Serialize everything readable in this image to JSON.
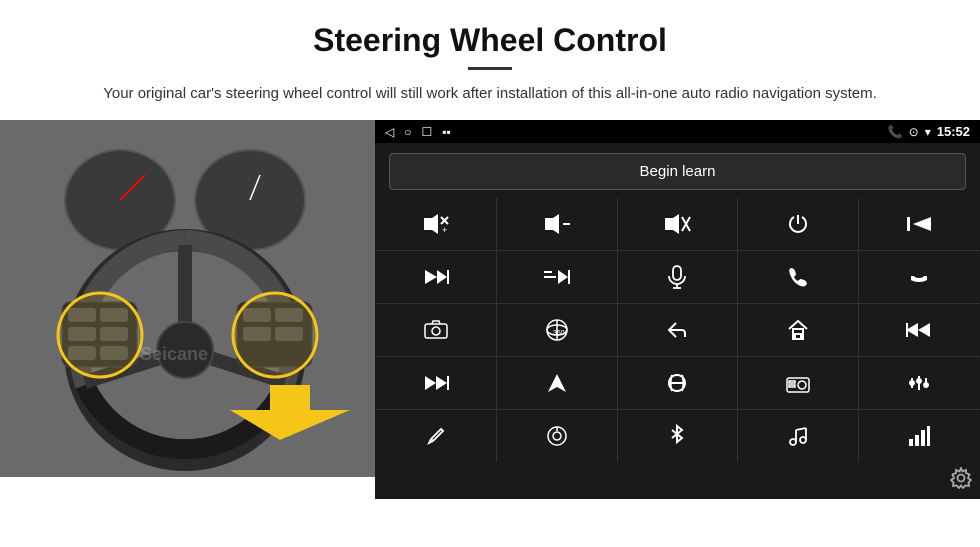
{
  "header": {
    "title": "Steering Wheel Control",
    "subtitle": "Your original car's steering wheel control will still work after installation of this all-in-one auto radio navigation system."
  },
  "status_bar": {
    "back_icon": "◁",
    "circle_icon": "○",
    "square_icon": "☐",
    "battery_icon": "▪▪",
    "phone_icon": "📞",
    "location_icon": "⊙",
    "wifi_icon": "▾",
    "time": "15:52"
  },
  "begin_learn": {
    "label": "Begin learn"
  },
  "watermark": "Seicane",
  "controls": [
    {
      "icon": "🔊+",
      "label": "vol-up"
    },
    {
      "icon": "🔊−",
      "label": "vol-down"
    },
    {
      "icon": "🔇",
      "label": "mute"
    },
    {
      "icon": "⏻",
      "label": "power"
    },
    {
      "icon": "⏮",
      "label": "prev-phone"
    },
    {
      "icon": "⏭",
      "label": "next"
    },
    {
      "icon": "✂⏭",
      "label": "skip"
    },
    {
      "icon": "🎤",
      "label": "mic"
    },
    {
      "icon": "📞",
      "label": "call"
    },
    {
      "icon": "📞↩",
      "label": "hang-up"
    },
    {
      "icon": "📷",
      "label": "camera"
    },
    {
      "icon": "360°",
      "label": "360-view"
    },
    {
      "icon": "↩",
      "label": "back"
    },
    {
      "icon": "⌂",
      "label": "home"
    },
    {
      "icon": "⏮⏮",
      "label": "prev"
    },
    {
      "icon": "⏭⏭",
      "label": "fast-fwd"
    },
    {
      "icon": "➤",
      "label": "nav"
    },
    {
      "icon": "⇄",
      "label": "source"
    },
    {
      "icon": "📻",
      "label": "radio"
    },
    {
      "icon": "⚙⚙",
      "label": "eq"
    },
    {
      "icon": "✏",
      "label": "edit"
    },
    {
      "icon": "⊙",
      "label": "knob"
    },
    {
      "icon": "✱",
      "label": "bluetooth"
    },
    {
      "icon": "♫",
      "label": "music"
    },
    {
      "icon": "📶",
      "label": "signal"
    }
  ],
  "settings_icon": "⚙"
}
